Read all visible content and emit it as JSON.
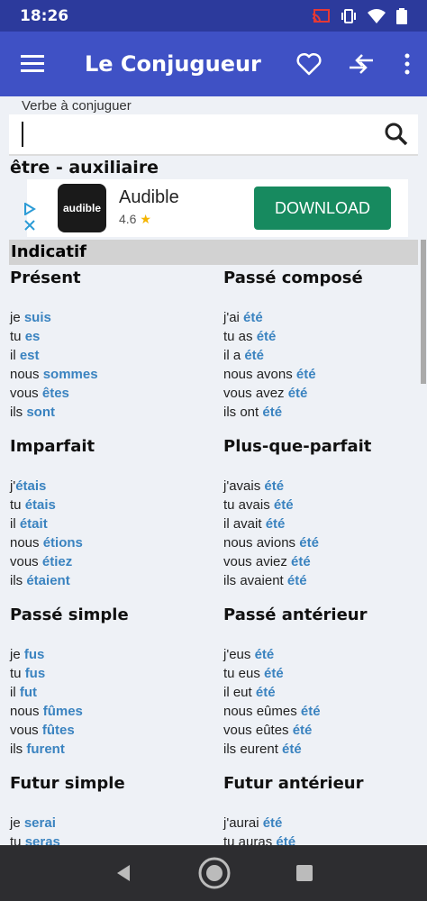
{
  "status_bar": {
    "time": "18:26"
  },
  "app_bar": {
    "title": "Le Conjugueur"
  },
  "search": {
    "label": "Verbe à conjuguer",
    "value": ""
  },
  "verb_title": "être - auxiliaire",
  "ad": {
    "logo_text": "audible",
    "name": "Audible",
    "rating": "4.6",
    "cta": "DOWNLOAD"
  },
  "section": "Indicatif",
  "tenses": [
    {
      "name": "Présent",
      "rows": [
        {
          "p": "je ",
          "v": "suis"
        },
        {
          "p": "tu ",
          "v": "es"
        },
        {
          "p": "il ",
          "v": "est"
        },
        {
          "p": "nous ",
          "v": "sommes"
        },
        {
          "p": "vous ",
          "v": "êtes"
        },
        {
          "p": "ils ",
          "v": "sont"
        }
      ]
    },
    {
      "name": "Passé composé",
      "rows": [
        {
          "p": "j'ai ",
          "v": "été"
        },
        {
          "p": "tu as ",
          "v": "été"
        },
        {
          "p": "il a ",
          "v": "été"
        },
        {
          "p": "nous avons ",
          "v": "été"
        },
        {
          "p": "vous avez ",
          "v": "été"
        },
        {
          "p": "ils ont ",
          "v": "été"
        }
      ]
    },
    {
      "name": "Imparfait",
      "rows": [
        {
          "p": "j'",
          "v": "étais"
        },
        {
          "p": "tu ",
          "v": "étais"
        },
        {
          "p": "il ",
          "v": "était"
        },
        {
          "p": "nous ",
          "v": "étions"
        },
        {
          "p": "vous ",
          "v": "étiez"
        },
        {
          "p": "ils ",
          "v": "étaient"
        }
      ]
    },
    {
      "name": "Plus-que-parfait",
      "rows": [
        {
          "p": "j'avais ",
          "v": "été"
        },
        {
          "p": "tu avais ",
          "v": "été"
        },
        {
          "p": "il avait ",
          "v": "été"
        },
        {
          "p": "nous avions ",
          "v": "été"
        },
        {
          "p": "vous aviez ",
          "v": "été"
        },
        {
          "p": "ils avaient ",
          "v": "été"
        }
      ]
    },
    {
      "name": "Passé simple",
      "rows": [
        {
          "p": "je ",
          "v": "fus"
        },
        {
          "p": "tu ",
          "v": "fus"
        },
        {
          "p": "il ",
          "v": "fut"
        },
        {
          "p": "nous ",
          "v": "fûmes"
        },
        {
          "p": "vous ",
          "v": "fûtes"
        },
        {
          "p": "ils ",
          "v": "furent"
        }
      ]
    },
    {
      "name": "Passé antérieur",
      "rows": [
        {
          "p": "j'eus ",
          "v": "été"
        },
        {
          "p": "tu eus ",
          "v": "été"
        },
        {
          "p": "il eut ",
          "v": "été"
        },
        {
          "p": "nous eûmes ",
          "v": "été"
        },
        {
          "p": "vous eûtes ",
          "v": "été"
        },
        {
          "p": "ils eurent ",
          "v": "été"
        }
      ]
    },
    {
      "name": "Futur simple",
      "rows": [
        {
          "p": "je ",
          "v": "serai"
        },
        {
          "p": "tu ",
          "v": "seras"
        }
      ]
    },
    {
      "name": "Futur antérieur",
      "rows": [
        {
          "p": "j'aurai ",
          "v": "été"
        },
        {
          "p": "tu auras ",
          "v": "été"
        }
      ]
    }
  ]
}
